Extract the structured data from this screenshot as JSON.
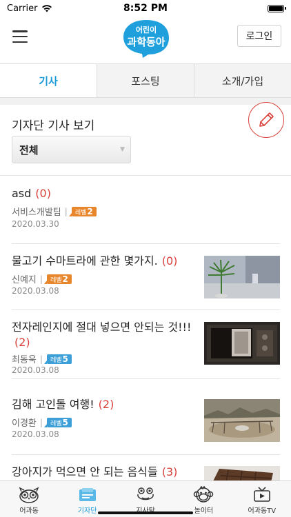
{
  "status_bar": {
    "carrier": "Carrier",
    "time": "8:52 PM"
  },
  "header": {
    "logo_top": "어린이",
    "logo_bottom": "과학동아",
    "login_label": "로그인"
  },
  "tabs": [
    {
      "label": "기사",
      "active": true
    },
    {
      "label": "포스팅",
      "active": false
    },
    {
      "label": "소개/가입",
      "active": false
    }
  ],
  "section": {
    "title": "기자단 기사 보기",
    "filter_value": "전체"
  },
  "articles": [
    {
      "title": "asd",
      "count": "(0)",
      "author": "서비스개발팀",
      "level_label": "레벨",
      "level_num": "2",
      "level_color": "#e8862c",
      "date": "2020.03.30",
      "thumb": "none"
    },
    {
      "title": "물고기 수마트라에 관한 몇가지.",
      "count": "(0)",
      "author": "신예지",
      "level_label": "레벨",
      "level_num": "2",
      "level_color": "#e8862c",
      "date": "2020.03.08",
      "thumb": "plant"
    },
    {
      "title_line1": "전자레인지에 절대 넣으면 안되는 것!!!",
      "count": "(2)",
      "author": "최동욱",
      "level_label": "레벨",
      "level_num": "5",
      "level_color": "#3d9fd7",
      "date": "2020.03.08",
      "thumb": "microwave"
    },
    {
      "title": "김해 고인돌 여행!",
      "count": "(2)",
      "author": "이경환",
      "level_label": "레벨",
      "level_num": "5",
      "level_color": "#3d9fd7",
      "date": "2020.03.08",
      "thumb": "dolmen"
    },
    {
      "title": "강아지가 먹으면 안 되는 음식들",
      "count": "(3)",
      "thumb": "chocolate"
    }
  ],
  "bottom_nav": [
    {
      "label": "어과동",
      "icon": "owl-icon",
      "active": false
    },
    {
      "label": "기자단",
      "icon": "press-card-icon",
      "active": true
    },
    {
      "label": "지사탐",
      "icon": "frog-icon",
      "active": false
    },
    {
      "label": "놀이터",
      "icon": "monkey-icon",
      "active": false
    },
    {
      "label": "어과동TV",
      "icon": "tv-icon",
      "active": false
    }
  ],
  "colors": {
    "accent": "#1a9bd7",
    "count_red": "#d9403a",
    "level_orange": "#e8862c",
    "level_blue": "#3d9fd7"
  }
}
